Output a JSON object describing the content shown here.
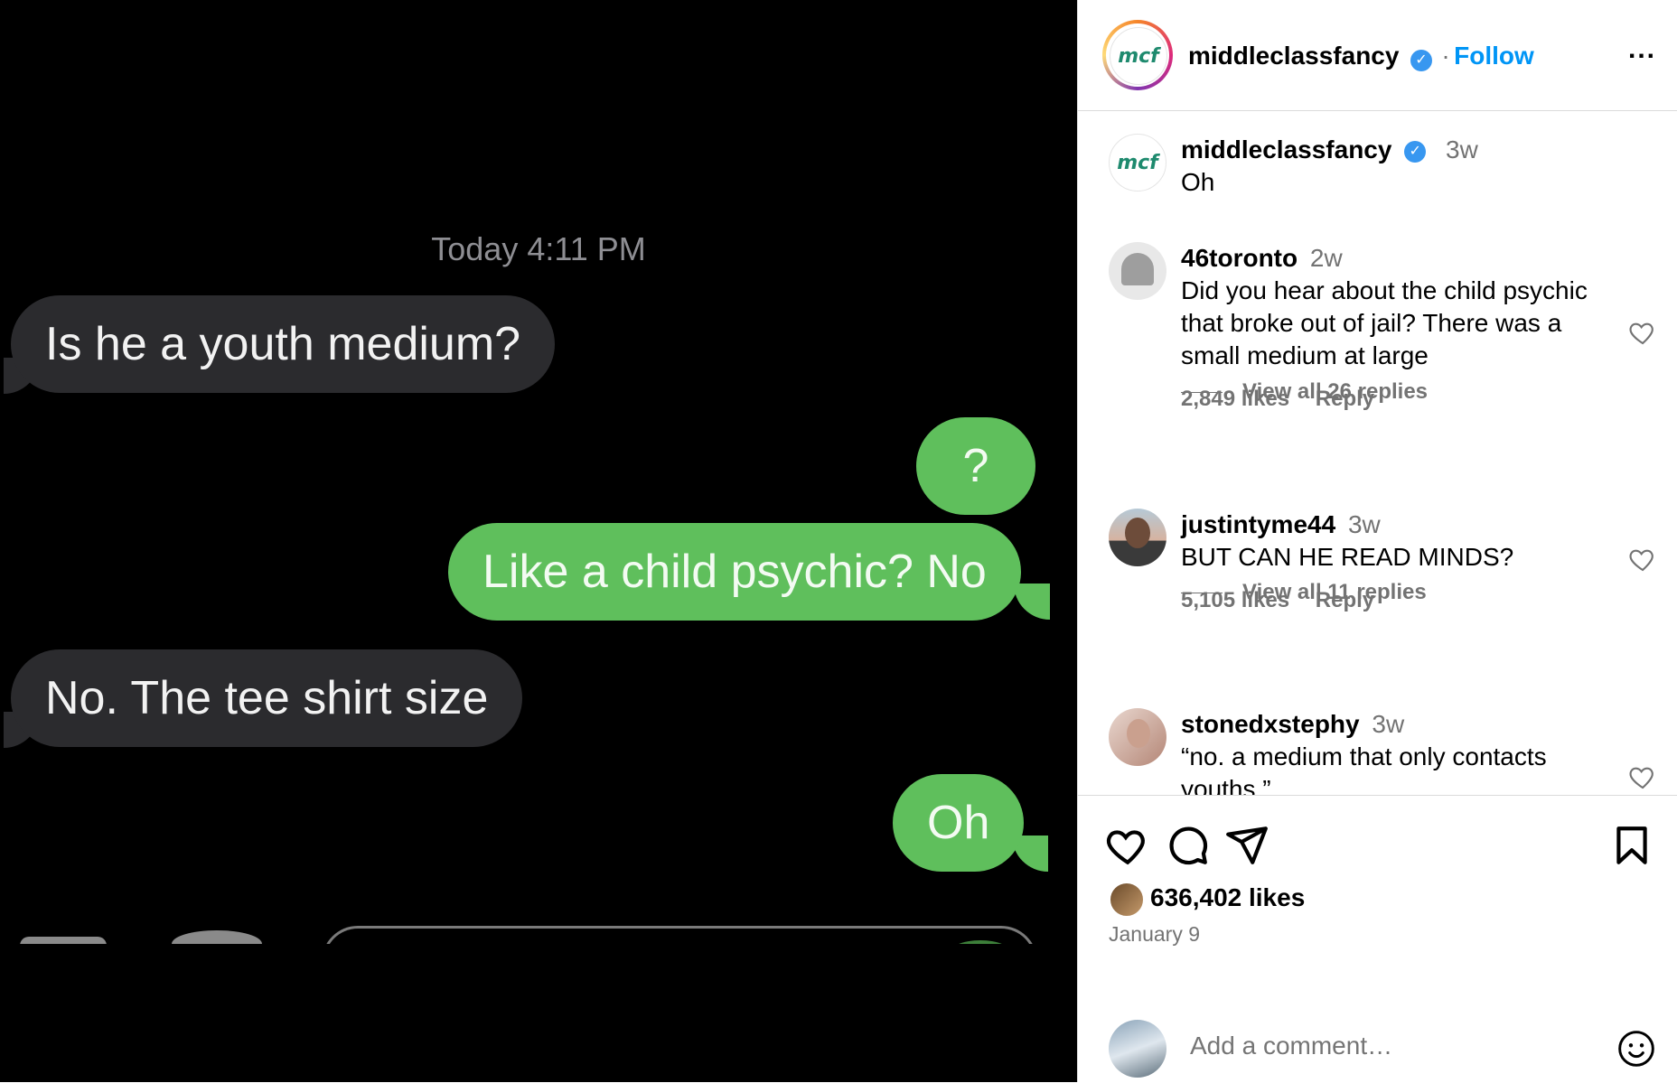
{
  "post": {
    "chat": {
      "timestamp": "Today 4:11 PM",
      "messages": [
        {
          "side": "in",
          "text": "Is he a youth medium?"
        },
        {
          "side": "out",
          "text": "?"
        },
        {
          "side": "out",
          "text": "Like a child psychic? No"
        },
        {
          "side": "in",
          "text": "No. The tee shirt size"
        },
        {
          "side": "out",
          "text": "Oh"
        }
      ]
    }
  },
  "header": {
    "logo_text": "mcf",
    "username": "middleclassfancy",
    "verified_glyph": "✓",
    "separator": "·",
    "follow_label": "Follow",
    "more_label": "..."
  },
  "caption": {
    "logo_text": "mcf",
    "username": "middleclassfancy",
    "time": "3w",
    "text": "Oh"
  },
  "comments": [
    {
      "username": "46toronto",
      "time": "2w",
      "text": "Did you hear about the child psychic that broke out of jail? There was a small medium at large",
      "likes": "2,849 likes",
      "reply_label": "Reply",
      "view_replies": "View all 26 replies"
    },
    {
      "username": "justintyme44",
      "time": "3w",
      "text": "BUT CAN HE READ MINDS?",
      "likes": "5,105 likes",
      "reply_label": "Reply",
      "view_replies": "View all 11 replies"
    },
    {
      "username": "stonedxstephy",
      "time": "3w",
      "text": "“no. a medium that only contacts youths.”"
    }
  ],
  "actions": {
    "likes_count": "636,402 likes",
    "date": "January 9"
  },
  "comment_box": {
    "placeholder": "Add a comment…"
  },
  "colors": {
    "accent": "#0095f6",
    "sent_bubble": "#5fbf5c",
    "received_bubble": "#2b2b2e"
  }
}
